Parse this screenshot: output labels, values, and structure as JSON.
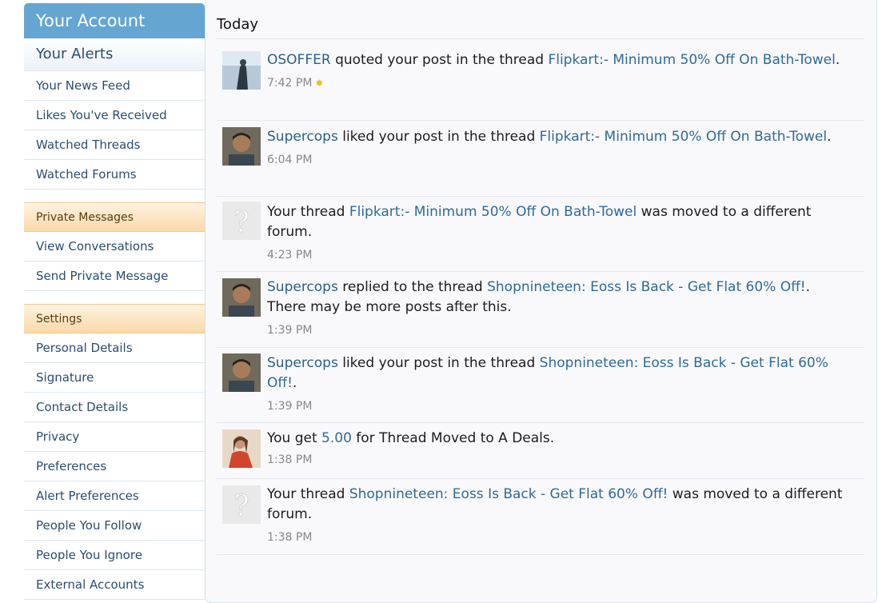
{
  "sidebar": {
    "header": "Your Account",
    "sub": "Your Alerts",
    "group1": [
      "Your News Feed",
      "Likes You've Received",
      "Watched Threads",
      "Watched Forums"
    ],
    "section_pm": "Private Messages",
    "group2": [
      "View Conversations",
      "Send Private Message"
    ],
    "section_settings": "Settings",
    "group3": [
      "Personal Details",
      "Signature",
      "Contact Details",
      "Privacy",
      "Preferences",
      "Alert Preferences",
      "People You Follow",
      "People You Ignore",
      "External Accounts"
    ]
  },
  "main": {
    "heading": "Today",
    "alerts": [
      {
        "user": "OSOFFER",
        "t1": " quoted your post in the thread ",
        "link": "Flipkart:- Minimum 50% Off On Bath-Towel",
        "t2": ".",
        "time": "7:42 PM",
        "avatar_icon": "user-photo-icon"
      },
      {
        "user": "Supercops",
        "t1": " liked your post in the thread ",
        "link": "Flipkart:- Minimum 50% Off On Bath-Towel",
        "t2": ".",
        "time": "6:04 PM",
        "avatar_icon": "user-photo-icon"
      },
      {
        "user": "",
        "t1": "Your thread ",
        "link": "Flipkart:- Minimum 50% Off On Bath-Towel",
        "t2": " was moved to a different forum.",
        "time": "4:23 PM",
        "avatar_icon": "unknown-user-icon"
      },
      {
        "user": "Supercops",
        "t1": " replied to the thread ",
        "link": "Shopnineteen: Eoss Is Back - Get Flat 60% Off!",
        "t2": ". There may be more posts after this.",
        "time": "1:39 PM",
        "avatar_icon": "user-photo-icon"
      },
      {
        "user": "Supercops",
        "t1": " liked your post in the thread ",
        "link": "Shopnineteen: Eoss Is Back - Get Flat 60% Off!",
        "t2": ".",
        "time": "1:39 PM",
        "avatar_icon": "user-photo-icon"
      },
      {
        "user": "",
        "t1": "You get ",
        "link": "5.00",
        "t2": " for Thread Moved to A Deals.",
        "time": "1:38 PM",
        "avatar_icon": "user-photo-icon"
      },
      {
        "user": "",
        "t1": "Your thread ",
        "link": "Shopnineteen: Eoss Is Back - Get Flat 60% Off!",
        "t2": " was moved to a different forum.",
        "time": "1:38 PM",
        "avatar_icon": "unknown-user-icon"
      }
    ]
  }
}
